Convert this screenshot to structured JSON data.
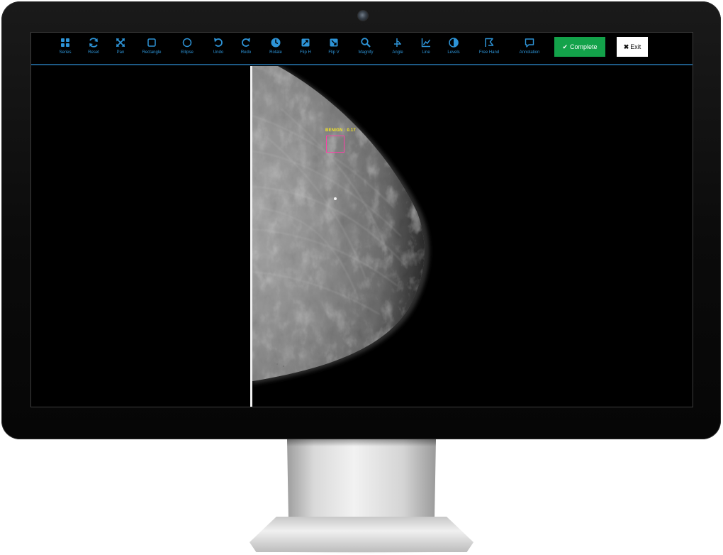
{
  "toolbar": {
    "tools": [
      {
        "label": "Series",
        "icon": "grid-icon"
      },
      {
        "label": "Reset",
        "icon": "refresh-icon"
      },
      {
        "label": "Pan",
        "icon": "pan-arrows-icon"
      },
      {
        "label": "Rectangle",
        "icon": "rectangle-icon"
      },
      {
        "label": "Ellipse",
        "icon": "ellipse-icon"
      },
      {
        "label": "Undo",
        "icon": "undo-icon"
      },
      {
        "label": "Redo",
        "icon": "redo-icon"
      },
      {
        "label": "Rotate",
        "icon": "rotate-icon"
      },
      {
        "label": "Flip H",
        "icon": "flip-h-icon"
      },
      {
        "label": "Flip V",
        "icon": "flip-v-icon"
      },
      {
        "label": "Magnify",
        "icon": "magnify-icon"
      },
      {
        "label": "Angle",
        "icon": "angle-icon"
      },
      {
        "label": "Line",
        "icon": "line-chart-icon"
      },
      {
        "label": "Levels",
        "icon": "contrast-icon"
      },
      {
        "label": "Free Hand",
        "icon": "freehand-icon"
      },
      {
        "label": "Annotation",
        "icon": "speech-bubble-icon"
      }
    ],
    "complete_label": "Complete",
    "exit_label": "Exit"
  },
  "viewer": {
    "finding_label": "BENIGN : 0.17"
  },
  "colors": {
    "tool_icon": "#2d93d6",
    "complete_button": "#13a24a",
    "finding_box": "#ff3fa8",
    "finding_text": "#f4e624",
    "toolbar_underline": "#1d5a86"
  }
}
